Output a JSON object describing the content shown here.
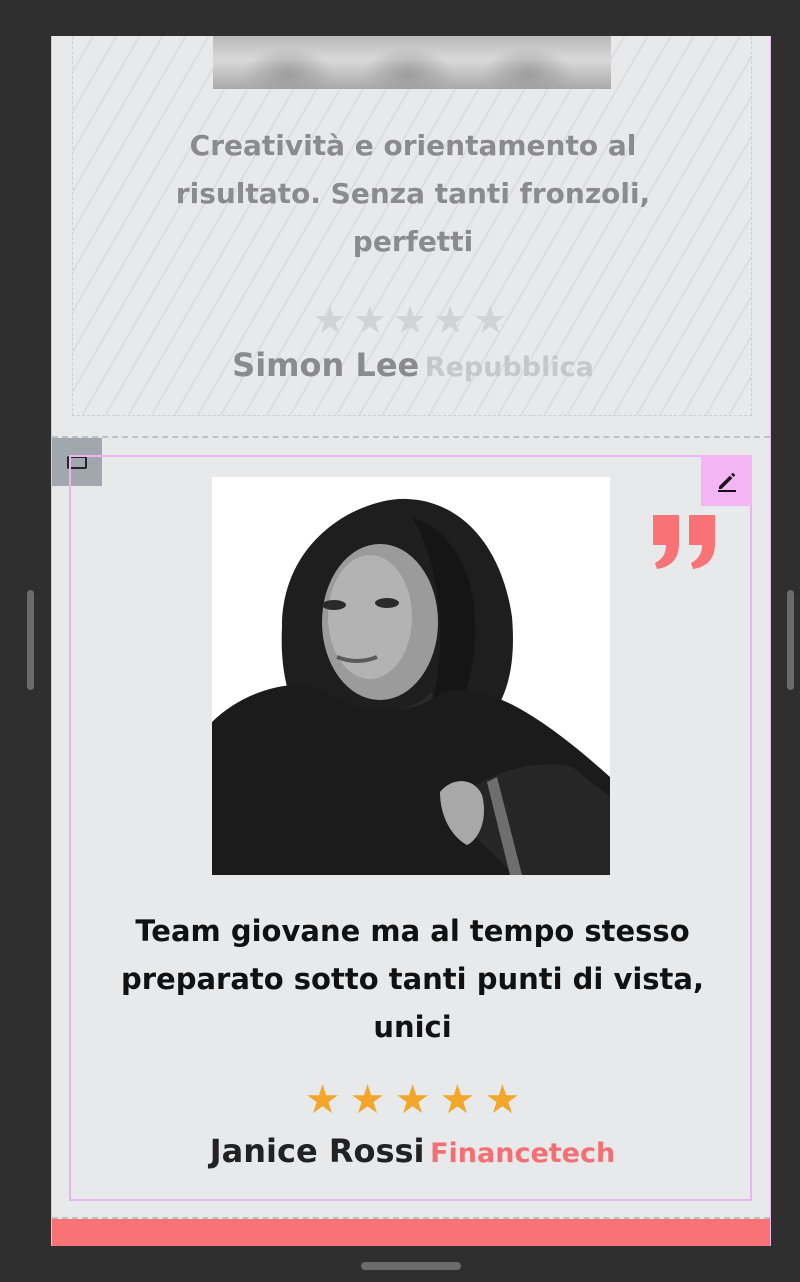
{
  "testimonials": [
    {
      "quote": "Creatività e orientamento al risultato. Senza tanti fronzoli, perfetti",
      "rating": 0,
      "stars": "★★★★★",
      "author": "Simon Lee",
      "company": "Repubblica"
    },
    {
      "quote": "Team giovane ma al tempo stesso preparato sotto tanti punti di vista, unici",
      "rating": 5,
      "stars": [
        "★",
        "★",
        "★",
        "★",
        "★"
      ],
      "author": "Janice Rossi",
      "company": "Financetech"
    }
  ],
  "colors": {
    "accent": "#f77375",
    "star_filled": "#f2a62a",
    "star_empty": "#d2d3d6",
    "selection_outline": "#eab5ef",
    "edit_button_bg": "#f3b5f3"
  },
  "icons": {
    "section_tab": "section-icon",
    "edit": "pencil-icon",
    "quote": "quote-icon"
  }
}
